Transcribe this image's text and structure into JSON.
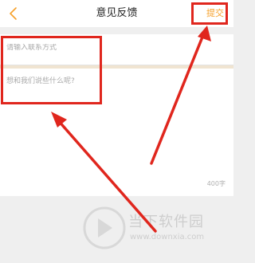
{
  "header": {
    "title": "意见反馈",
    "submit_label": "提交",
    "back_icon": "chevron-left-icon"
  },
  "form": {
    "contact_placeholder": "请输入联系方式",
    "feedback_placeholder": "想和我们说些什么呢?",
    "char_limit": "400字"
  },
  "colors": {
    "accent": "#f6a12b",
    "highlight": "#e0261d",
    "background": "#efefef"
  },
  "watermark": {
    "name": "当下软件园",
    "url": "www.downxia.com"
  }
}
